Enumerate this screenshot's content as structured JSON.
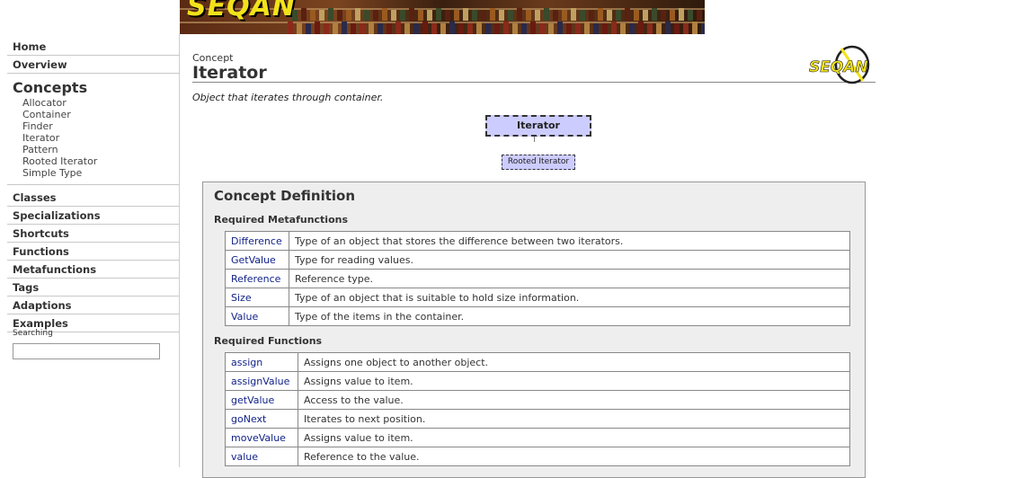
{
  "banner": {
    "logo_text": "SEQAN"
  },
  "sidebar": {
    "top_items": [
      "Home",
      "Overview"
    ],
    "concepts_heading": "Concepts",
    "concept_items": [
      "Allocator",
      "Container",
      "Finder",
      "Iterator",
      "Pattern",
      "Rooted Iterator",
      "Simple Type"
    ],
    "bottom_items": [
      "Classes",
      "Specializations",
      "Shortcuts",
      "Functions",
      "Metafunctions",
      "Tags",
      "Adaptions",
      "Examples"
    ],
    "search_label": "Searching",
    "search_value": ""
  },
  "header": {
    "kind": "Concept",
    "title": "Iterator",
    "logo_text": "SEQAN"
  },
  "brief": "Object that iterates through container.",
  "diagram": {
    "parent": "Iterator",
    "child": "Rooted Iterator"
  },
  "definition": {
    "title": "Concept Definition",
    "metafunctions_heading": "Required Metafunctions",
    "metafunctions": [
      {
        "name": "Difference",
        "desc": "Type of an object that stores the difference between two iterators."
      },
      {
        "name": "GetValue",
        "desc": "Type for reading values."
      },
      {
        "name": "Reference",
        "desc": "Reference type."
      },
      {
        "name": "Size",
        "desc": "Type of an object that is suitable to hold size information."
      },
      {
        "name": "Value",
        "desc": "Type of the items in the container."
      }
    ],
    "functions_heading": "Required Functions",
    "functions": [
      {
        "name": "assign",
        "desc": "Assigns one object to another object."
      },
      {
        "name": "assignValue",
        "desc": "Assigns value to item."
      },
      {
        "name": "getValue",
        "desc": "Access to the value."
      },
      {
        "name": "goNext",
        "desc": "Iterates to next position."
      },
      {
        "name": "moveValue",
        "desc": "Assigns value to item."
      },
      {
        "name": "value",
        "desc": "Reference to the value."
      }
    ]
  },
  "colors": {
    "diagram_fill": "#ccccff",
    "link": "#112288",
    "panel": "#eeeeee"
  }
}
